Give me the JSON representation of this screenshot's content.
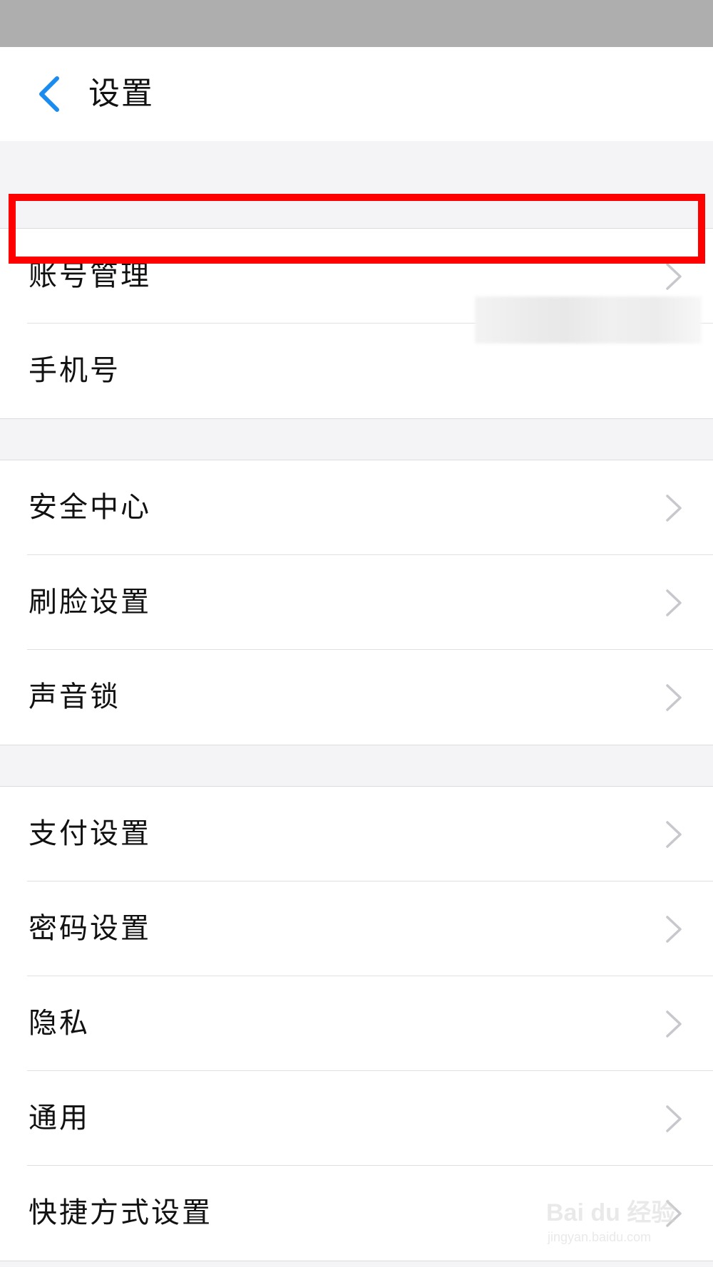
{
  "header": {
    "title": "设置",
    "back_icon": "chevron-left-icon",
    "accent_color": "#1a8cf0"
  },
  "groups": [
    {
      "items": [
        {
          "label": "账号管理",
          "icon": "chevron-right-icon",
          "highlighted": true
        },
        {
          "label": "手机号",
          "value_blurred": true
        }
      ]
    },
    {
      "items": [
        {
          "label": "安全中心",
          "icon": "chevron-right-icon"
        },
        {
          "label": "刷脸设置",
          "icon": "chevron-right-icon"
        },
        {
          "label": "声音锁",
          "icon": "chevron-right-icon"
        }
      ]
    },
    {
      "items": [
        {
          "label": "支付设置",
          "icon": "chevron-right-icon"
        },
        {
          "label": "密码设置",
          "icon": "chevron-right-icon"
        },
        {
          "label": "隐私",
          "icon": "chevron-right-icon"
        },
        {
          "label": "通用",
          "icon": "chevron-right-icon"
        },
        {
          "label": "快捷方式设置",
          "icon": "chevron-right-icon"
        }
      ]
    }
  ],
  "annotation": {
    "highlight_color": "#ff0000"
  },
  "watermark": {
    "main": "Bai du 经验",
    "sub": "jingyan.baidu.com"
  }
}
